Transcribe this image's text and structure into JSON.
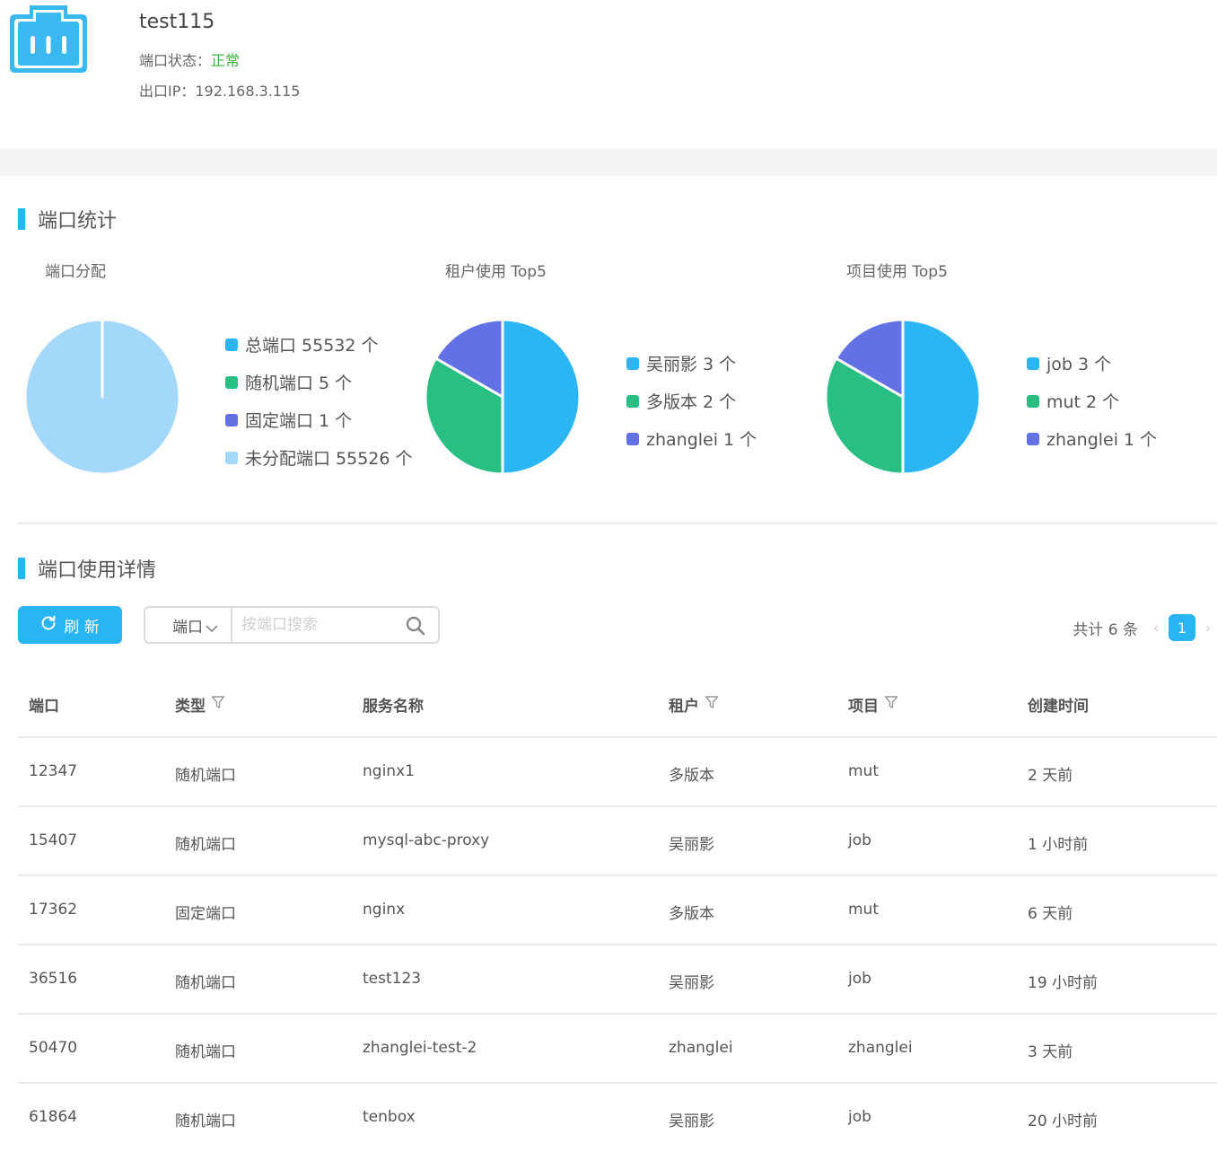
{
  "header": {
    "title": "test115",
    "status_label": "端口状态：",
    "status_value": "正常",
    "ip_label": "出口IP：",
    "ip_value": "192.168.3.115"
  },
  "stats_section": {
    "title": "端口统计",
    "charts": [
      {
        "title": "端口分配",
        "legend": [
          {
            "label": "总端口 55532 个",
            "color": "#2bb6f3"
          },
          {
            "label": "随机端口 5 个",
            "color": "#2abf82"
          },
          {
            "label": "固定端口 1 个",
            "color": "#6272e6"
          },
          {
            "label": "未分配端口 55526 个",
            "color": "#a3d8fa"
          }
        ]
      },
      {
        "title": "租户使用 Top5",
        "legend": [
          {
            "label": "吴丽影 3 个",
            "color": "#2bb6f3"
          },
          {
            "label": "多版本 2 个",
            "color": "#2abf82"
          },
          {
            "label": "zhanglei 1 个",
            "color": "#6272e6"
          }
        ]
      },
      {
        "title": "项目使用 Top5",
        "legend": [
          {
            "label": "job 3 个",
            "color": "#2bb6f3"
          },
          {
            "label": "mut 2 个",
            "color": "#2abf82"
          },
          {
            "label": "zhanglei 1 个",
            "color": "#6272e6"
          }
        ]
      }
    ]
  },
  "chart_data": [
    {
      "type": "pie",
      "title": "端口分配",
      "categories": [
        "随机端口",
        "固定端口",
        "未分配端口"
      ],
      "values": [
        5,
        1,
        55526
      ],
      "colors": [
        "#2abf82",
        "#6272e6",
        "#a3d8fa"
      ]
    },
    {
      "type": "pie",
      "title": "租户使用 Top5",
      "categories": [
        "吴丽影",
        "多版本",
        "zhanglei"
      ],
      "values": [
        3,
        2,
        1
      ],
      "colors": [
        "#2bb6f3",
        "#2abf82",
        "#6272e6"
      ]
    },
    {
      "type": "pie",
      "title": "项目使用 Top5",
      "categories": [
        "job",
        "mut",
        "zhanglei"
      ],
      "values": [
        3,
        2,
        1
      ],
      "colors": [
        "#2bb6f3",
        "#2abf82",
        "#6272e6"
      ]
    }
  ],
  "details_section": {
    "title": "端口使用详情",
    "refresh_label": "刷 新",
    "search_select": "端口",
    "search_placeholder": "按端口搜索",
    "total_label": "共计 6 条",
    "current_page": "1"
  },
  "table": {
    "headers": [
      "端口",
      "类型",
      "服务名称",
      "租户",
      "项目",
      "创建时间"
    ],
    "rows": [
      [
        "12347",
        "随机端口",
        "nginx1",
        "多版本",
        "mut",
        "2 天前"
      ],
      [
        "15407",
        "随机端口",
        "mysql-abc-proxy",
        "吴丽影",
        "job",
        "1 小时前"
      ],
      [
        "17362",
        "固定端口",
        "nginx",
        "多版本",
        "mut",
        "6 天前"
      ],
      [
        "36516",
        "随机端口",
        "test123",
        "吴丽影",
        "job",
        "19 小时前"
      ],
      [
        "50470",
        "随机端口",
        "zhanglei-test-2",
        "zhanglei",
        "zhanglei",
        "3 天前"
      ],
      [
        "61864",
        "随机端口",
        "tenbox",
        "吴丽影",
        "job",
        "20 小时前"
      ]
    ]
  },
  "colors": {
    "accent": "#29b5f2",
    "status_ok": "#3cb33c"
  }
}
